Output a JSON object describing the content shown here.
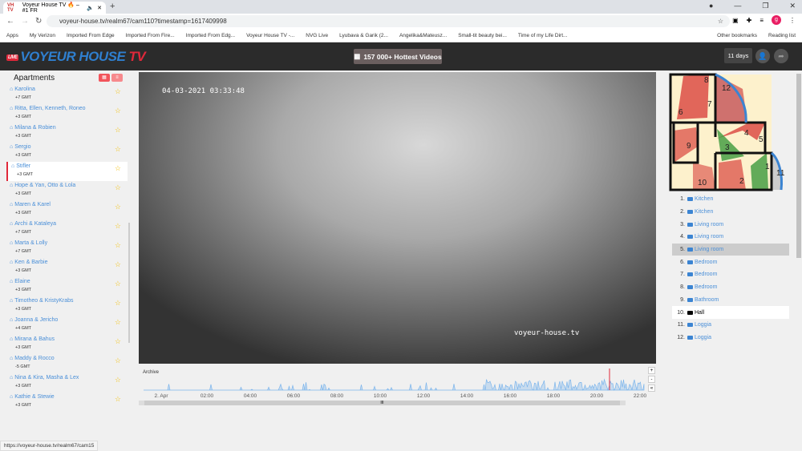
{
  "browser": {
    "tab_title": "Voyeur House TV 🔥 – #1 FR",
    "tab_favicon": "VH TV",
    "url": "voyeur-house.tv/realm67/cam110?timestamp=1617409998",
    "profile_initial": "g",
    "bookmarks": [
      "Apps",
      "My Verizon",
      "Imported From Edge",
      "Imported From Fire...",
      "Imported From Edg...",
      "Voyeur House TV -...",
      "NVG Live",
      "Lyubava & Garik (2...",
      "Angelika&Mateusz...",
      "Small-tit beauty bei...",
      "Time of my Life Dirt..."
    ],
    "other_bookmarks": "Other bookmarks",
    "reading_list": "Reading list",
    "status_url": "https://voyeur-house.tv/realm67/cam15"
  },
  "header": {
    "logo_main": "VOYEUR HOUSE ",
    "logo_tv": "TV",
    "logo_live": "LIVE",
    "hot_videos": "157 000+ Hottest Videos",
    "days": "11 days"
  },
  "sidebar": {
    "title": "Apartments",
    "apartments": [
      {
        "name": "Karolina",
        "gmt": "+7 GMT"
      },
      {
        "name": "Ritta, Ellen, Kenneth, Roneo",
        "gmt": "+3 GMT"
      },
      {
        "name": "Milana & Robien",
        "gmt": "+3 GMT"
      },
      {
        "name": "Sergio",
        "gmt": "+3 GMT"
      },
      {
        "name": "Stifler",
        "gmt": "+3 GMT",
        "active": true
      },
      {
        "name": "Hope & Yan, Otto & Lola",
        "gmt": "+3 GMT"
      },
      {
        "name": "Maren & Karel",
        "gmt": "+3 GMT"
      },
      {
        "name": "Archi & Kataleya",
        "gmt": "+7 GMT"
      },
      {
        "name": "Marta & Lolly",
        "gmt": "+7 GMT"
      },
      {
        "name": "Ken & Barbie",
        "gmt": "+3 GMT"
      },
      {
        "name": "Elaine",
        "gmt": "+3 GMT"
      },
      {
        "name": "Timotheo & KristyKrabs",
        "gmt": "+3 GMT"
      },
      {
        "name": "Joanna & Jericho",
        "gmt": "+4 GMT"
      },
      {
        "name": "Mirana & Bahus",
        "gmt": "+3 GMT"
      },
      {
        "name": "Maddy & Rocco",
        "gmt": "-5 GMT"
      },
      {
        "name": "Nina & Kira, Masha & Lex",
        "gmt": "+3 GMT"
      },
      {
        "name": "Kathie & Stewie",
        "gmt": "+3 GMT"
      }
    ]
  },
  "video": {
    "timestamp": "04-03-2021 03:33:48",
    "watermark": "voyeur-house.tv"
  },
  "archive": {
    "label": "Archive",
    "ticks": [
      "2. Apr",
      "02:00",
      "04:00",
      "06:00",
      "08:00",
      "10:00",
      "12:00",
      "14:00",
      "16:00",
      "18:00",
      "20:00",
      "22:00"
    ],
    "line_color": "#7cb5ec",
    "marker_color": "#e0283a"
  },
  "floorplan": {
    "labels": [
      "1",
      "2",
      "3",
      "4",
      "5",
      "6",
      "7",
      "8",
      "9",
      "10",
      "11",
      "12"
    ]
  },
  "cameras": [
    {
      "num": "1.",
      "room": "Kitchen"
    },
    {
      "num": "2.",
      "room": "Kitchen"
    },
    {
      "num": "3.",
      "room": "Living room"
    },
    {
      "num": "4.",
      "room": "Living room"
    },
    {
      "num": "5.",
      "room": "Living room",
      "state": "sel"
    },
    {
      "num": "6.",
      "room": "Bedroom"
    },
    {
      "num": "7.",
      "room": "Bedroom"
    },
    {
      "num": "8.",
      "room": "Bedroom"
    },
    {
      "num": "9.",
      "room": "Bathroom"
    },
    {
      "num": "10.",
      "room": "Hall",
      "state": "cur"
    },
    {
      "num": "11.",
      "room": "Loggia"
    },
    {
      "num": "12.",
      "room": "Loggia"
    }
  ]
}
